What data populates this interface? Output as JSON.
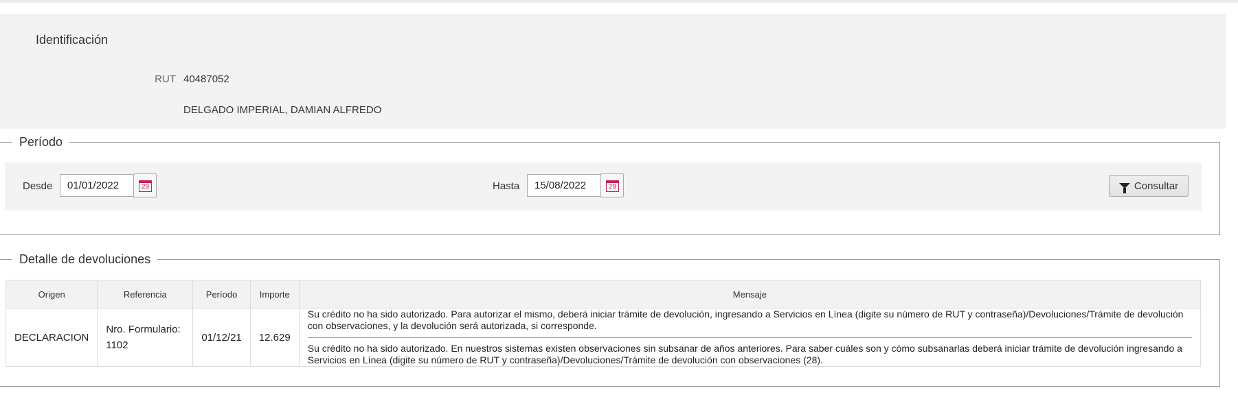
{
  "identificacion": {
    "title": "Identificación",
    "rut_label": "RUT",
    "rut_value": "40487052",
    "name": "DELGADO IMPERIAL, DAMIAN ALFREDO"
  },
  "periodo": {
    "legend": "Período",
    "desde_label": "Desde",
    "desde_value": "01/01/2022",
    "hasta_label": "Hasta",
    "hasta_value": "15/08/2022",
    "calendar_day": "29",
    "consultar_label": "Consultar"
  },
  "detalle": {
    "legend": "Detalle de devoluciones",
    "columns": [
      "Origen",
      "Referencia",
      "Período",
      "Importe",
      "Mensaje"
    ],
    "rows": [
      {
        "origen": "DECLARACION",
        "referencia_1": "Nro. Formulario:",
        "referencia_2": "1102",
        "periodo": "01/12/21",
        "importe": "12.629",
        "mensajes": [
          "Su crédito no ha sido autorizado. Para autorizar el mismo, deberá iniciar trámite de devolución, ingresando a Servicios en Línea (digite su número de RUT y contraseña)/Devoluciones/Trámite de devolución con observaciones, y la devolución será autorizada, si corresponde.",
          "Su crédito no ha sido autorizado. En nuestros sistemas existen observaciones sin subsanar de años anteriores. Para saber cuáles son y cómo subsanarlas deberá iniciar trámite de devolución ingresando a Servicios en Línea (digite su número de RUT y contraseña)/Devoluciones/Trámite de devolución con observaciones (28)."
        ]
      }
    ]
  },
  "colors": {
    "accent_calendar": "#c41f5c",
    "panel_bg": "#f3f3f3"
  }
}
